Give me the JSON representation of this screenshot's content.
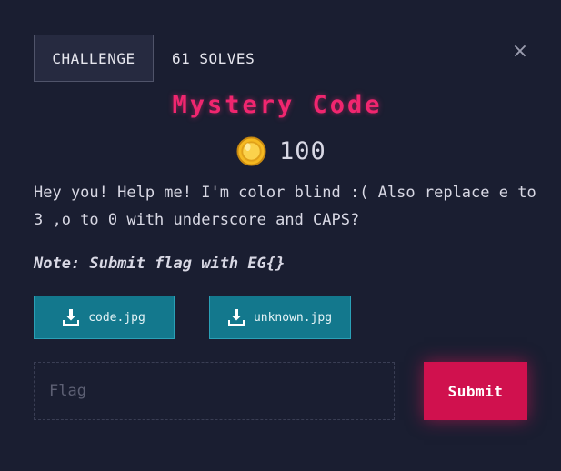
{
  "header": {
    "tab_challenge": "CHALLENGE",
    "tab_solves": "61 SOLVES",
    "close_glyph": "×"
  },
  "challenge": {
    "title": "Mystery Code",
    "points": "100",
    "description": "Hey you! Help me! I'm color blind :( Also replace e to\n3 ,o to 0 with underscore and CAPS?",
    "note": "Note: Submit flag with EG{}"
  },
  "files": [
    {
      "name": "code.jpg",
      "icon": "download-icon"
    },
    {
      "name": "unknown.jpg",
      "icon": "download-icon"
    }
  ],
  "form": {
    "flag_placeholder": "Flag",
    "flag_value": "",
    "submit_label": "Submit"
  },
  "colors": {
    "background": "#1a1e31",
    "title": "#f0266f",
    "file_button": "#13788d",
    "submit_button": "#d0114e",
    "coin": "#f5b921"
  }
}
